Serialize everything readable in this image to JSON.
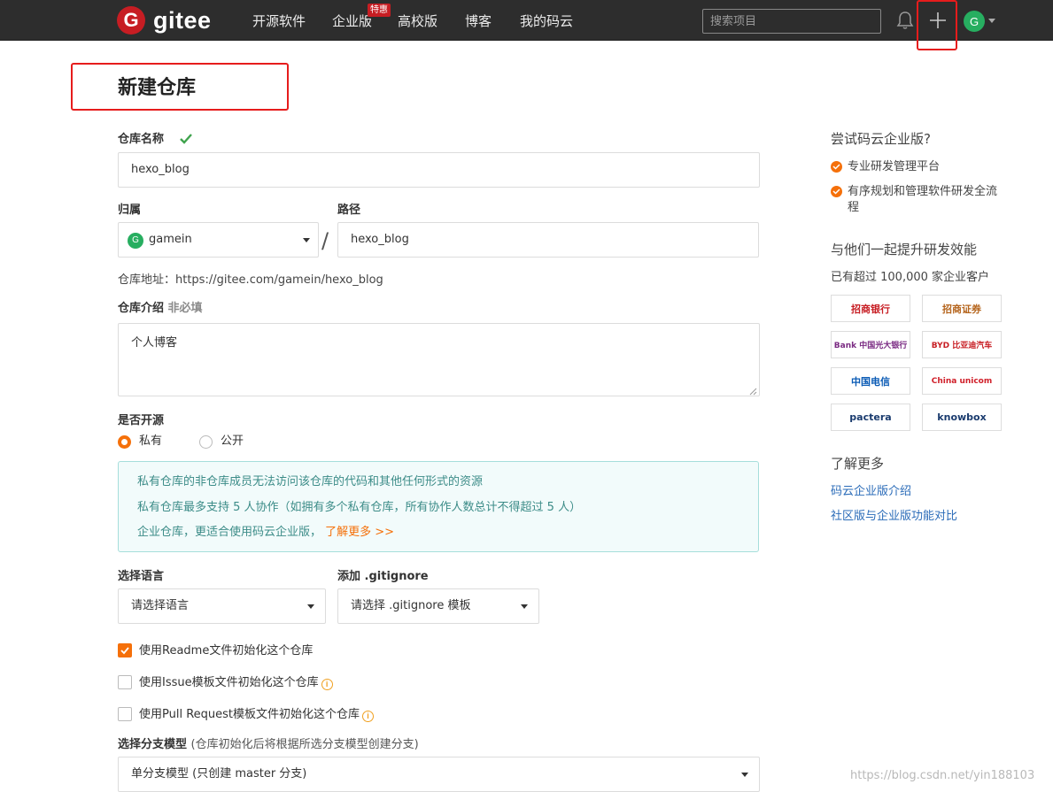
{
  "navbar": {
    "logo_glyph": "G",
    "logo_text": "gitee",
    "links": [
      "开源软件",
      "企业版",
      "高校版",
      "博客",
      "我的码云"
    ],
    "enterprise_badge": "特惠",
    "search_placeholder": "搜索项目",
    "avatar_letter": "G",
    "bell_icon": "bell-icon",
    "plus_icon": "plus-icon"
  },
  "page": {
    "title": "新建仓库"
  },
  "form": {
    "repo_name_label": "仓库名称",
    "repo_name_value": "hexo_blog",
    "owner_label": "归属",
    "owner_avatar": "G",
    "owner_value": "gamein",
    "path_label": "路径",
    "path_value": "hexo_blog",
    "separator": "/",
    "repo_url": "仓库地址：https://gitee.com/gamein/hexo_blog",
    "desc_label": "仓库介绍",
    "desc_optional": "非必填",
    "desc_value": "个人博客",
    "visibility_label": "是否开源",
    "visibility_options": [
      "私有",
      "公开"
    ],
    "visibility_selected": "私有",
    "info_lines": [
      "私有仓库的非仓库成员无法访问该仓库的代码和其他任何形式的资源",
      "私有仓库最多支持 5 人协作（如拥有多个私有仓库，所有协作人数总计不得超过 5 人）",
      "企业仓库，更适合使用码云企业版，"
    ],
    "info_link": "了解更多 >>",
    "language_label": "选择语言",
    "language_value": "请选择语言",
    "gitignore_label": "添加 .gitignore",
    "gitignore_value": "请选择 .gitignore 模板",
    "checkboxes": [
      {
        "label": "使用Readme文件初始化这个仓库",
        "checked": true
      },
      {
        "label": "使用Issue模板文件初始化这个仓库",
        "checked": false
      },
      {
        "label": "使用Pull Request模板文件初始化这个仓库",
        "checked": false
      }
    ],
    "info_icon_glyph": "i",
    "branch_label": "选择分支模型",
    "branch_hint": "(仓库初始化后将根据所选分支模型创建分支)",
    "branch_value": "单分支模型 (只创建 master 分支)"
  },
  "sidebar": {
    "try_title": "尝试码云企业版?",
    "features": [
      "专业研发管理平台",
      "有序规划和管理软件研发全流程"
    ],
    "together_title": "与他们一起提升研发效能",
    "customers_text": "已有超过 100,000 家企业客户",
    "customer_logos": [
      "招商银行",
      "招商证券",
      "Bank 中国光大银行",
      "BYD 比亚迪汽车",
      "中国电信",
      "China unicom",
      "pactera",
      "knowbox"
    ],
    "learn_title": "了解更多",
    "links": [
      "码云企业版介绍",
      "社区版与企业版功能对比"
    ]
  },
  "watermark": "https://blog.csdn.net/yin188103",
  "colors": {
    "accent": "#f5700a",
    "nav_bg": "#2d2d2d",
    "brand_red": "#c71d23",
    "annotation": "#e61c1c"
  }
}
